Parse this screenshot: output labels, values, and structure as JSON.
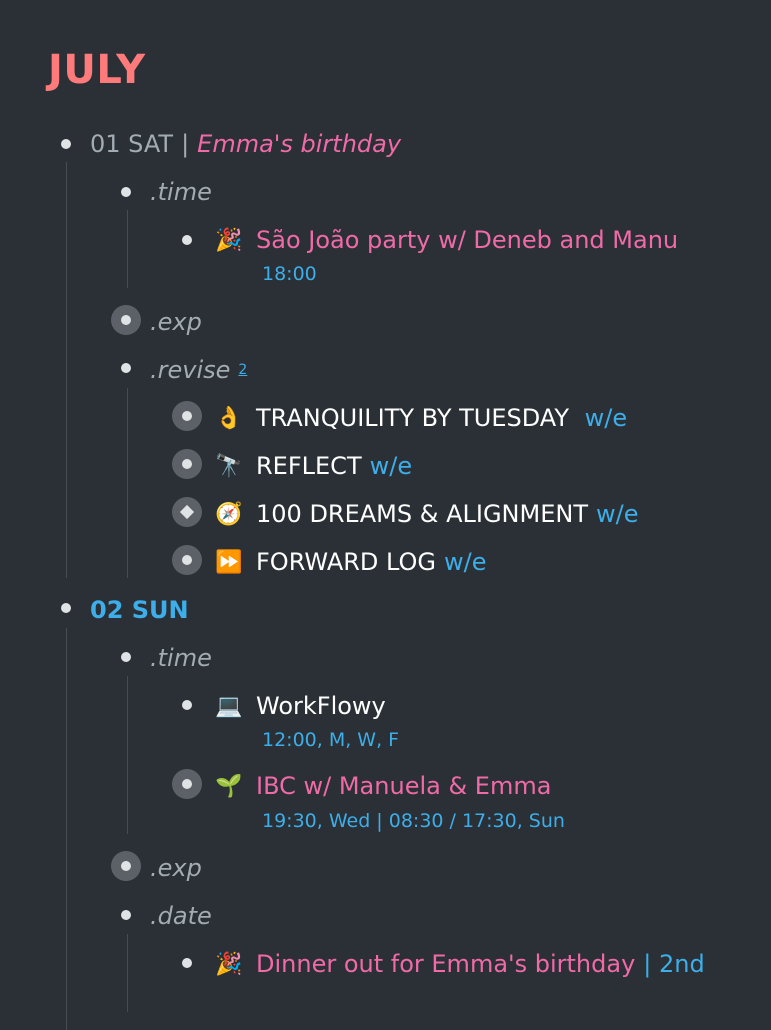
{
  "page": {
    "title": "JULY"
  },
  "days": [
    {
      "date_label": "01 SAT",
      "separator": "|",
      "event": "Emma's birthday",
      "time_label": ".time",
      "time_item": {
        "icon": "🎉",
        "text": "São João party w/ Deneb and Manu",
        "note": "18:00"
      },
      "exp_label": ".exp",
      "revise_label": ".revise",
      "revise_count": "2",
      "revise_items": [
        {
          "icon": "👌",
          "text": "TRANQUILITY BY TUESDAY ",
          "tag": "w/e"
        },
        {
          "icon": "🔭",
          "text": "REFLECT",
          "tag": "w/e"
        },
        {
          "icon": "🧭",
          "text": "100 DREAMS & ALIGNMENT",
          "tag": "w/e"
        },
        {
          "icon": "⏩",
          "text": "FORWARD LOG",
          "tag": "w/e"
        }
      ]
    },
    {
      "date_label": "02 SUN",
      "time_label": ".time",
      "time_items": [
        {
          "icon": "💻",
          "text": "WorkFlowy",
          "note": "12:00, M, W, F"
        },
        {
          "icon": "🌱",
          "text": "IBC w/ Manuela & Emma",
          "note": "19:30, Wed | 08:30 / 17:30, Sun"
        }
      ],
      "exp_label": ".exp",
      "date_sub_label": ".date",
      "date_item": {
        "icon": "🎉",
        "text": "Dinner out for Emma's birthday",
        "suffix": "| 2nd"
      }
    }
  ]
}
